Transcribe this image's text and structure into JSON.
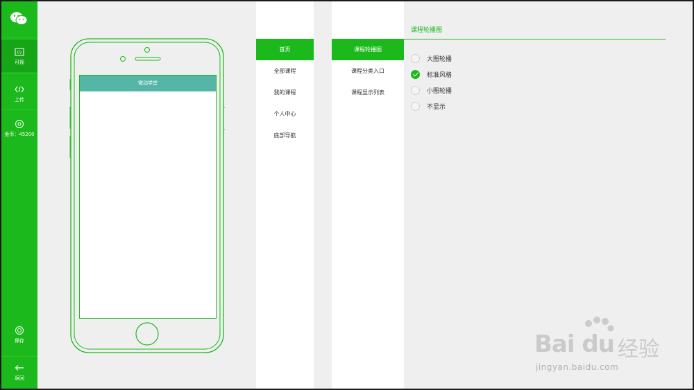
{
  "sidebar": {
    "logo_icon": "wechat-logo-icon",
    "items": [
      {
        "label": "可视",
        "icon": "visual-icon"
      },
      {
        "label": "上传",
        "icon": "code-icon"
      },
      {
        "label": "金币：45200",
        "icon": "coin-icon"
      }
    ],
    "bottom": [
      {
        "label": "保存",
        "icon": "save-icon"
      },
      {
        "label": "返回",
        "icon": "back-arrow-icon"
      }
    ]
  },
  "phone": {
    "title": "微动学堂"
  },
  "menu1": {
    "items": [
      "首页",
      "全部课程",
      "我的课程",
      "个人中心",
      "底部导航"
    ],
    "active": 0
  },
  "menu2": {
    "items": [
      "课程轮播图",
      "课程分类入口",
      "课程显示列表"
    ],
    "active": 0
  },
  "settings": {
    "title": "课程轮播图",
    "options": [
      {
        "label": "大图轮播",
        "checked": false
      },
      {
        "label": "标准风格",
        "checked": true
      },
      {
        "label": "小图轮播",
        "checked": false
      },
      {
        "label": "不显示",
        "checked": false
      }
    ]
  },
  "watermark": {
    "brand": "Bai du",
    "cn": "经验",
    "url": "jingyan.baidu.com"
  },
  "colors": {
    "accent": "#1bb91b",
    "phone_header": "#55b5a6",
    "background": "#efefef"
  }
}
